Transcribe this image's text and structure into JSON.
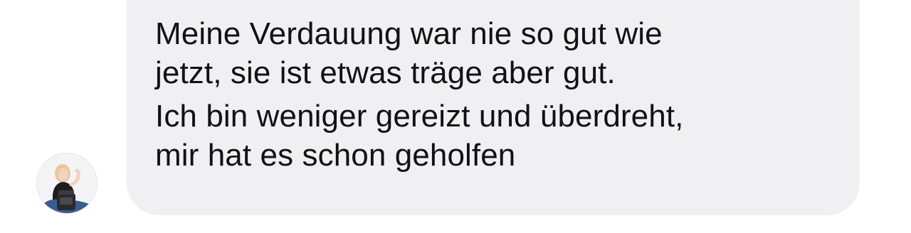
{
  "message": {
    "paragraphs": [
      {
        "lines": [
          "Meine Verdauung war nie so gut wie",
          "jetzt, sie ist etwas träge aber gut."
        ]
      },
      {
        "lines": [
          "Ich bin weniger gereizt und überdreht,",
          "mir hat es schon geholfen"
        ]
      }
    ]
  },
  "colors": {
    "bubble_background": "#f0f0f2",
    "text": "#121212"
  },
  "icons": {
    "avatar": "user-avatar-photo"
  }
}
